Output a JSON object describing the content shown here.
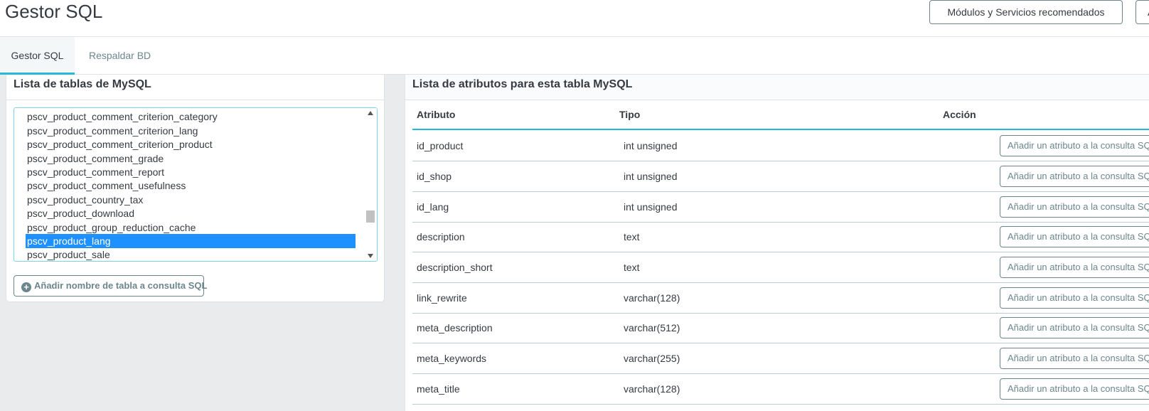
{
  "header": {
    "title": "Gestor SQL",
    "modules_button": "Módulos y Servicios recomendados",
    "cut_button": "A"
  },
  "tabs": [
    {
      "label": "Gestor SQL",
      "active": true
    },
    {
      "label": "Respaldar BD",
      "active": false
    }
  ],
  "left_panel": {
    "title": "Lista de tablas de MySQL",
    "tables": [
      "pscv_product_comment_criterion_category",
      "pscv_product_comment_criterion_lang",
      "pscv_product_comment_criterion_product",
      "pscv_product_comment_grade",
      "pscv_product_comment_report",
      "pscv_product_comment_usefulness",
      "pscv_product_country_tax",
      "pscv_product_download",
      "pscv_product_group_reduction_cache",
      "pscv_product_lang",
      "pscv_product_sale"
    ],
    "selected": "pscv_product_lang",
    "add_button": "Añadir nombre de tabla a consulta SQL"
  },
  "right_panel": {
    "title": "Lista de atributos para esta tabla MySQL",
    "columns": [
      "Atributo",
      "Tipo",
      "Acción"
    ],
    "rows": [
      {
        "attribute": "id_product",
        "type": "int unsigned",
        "action": "Añadir un atributo a la consulta SQL"
      },
      {
        "attribute": "id_shop",
        "type": "int unsigned",
        "action": "Añadir un atributo a la consulta SQL"
      },
      {
        "attribute": "id_lang",
        "type": "int unsigned",
        "action": "Añadir un atributo a la consulta SQL"
      },
      {
        "attribute": "description",
        "type": "text",
        "action": "Añadir un atributo a la consulta SQL"
      },
      {
        "attribute": "description_short",
        "type": "text",
        "action": "Añadir un atributo a la consulta SQL"
      },
      {
        "attribute": "link_rewrite",
        "type": "varchar(128)",
        "action": "Añadir un atributo a la consulta SQL"
      },
      {
        "attribute": "meta_description",
        "type": "varchar(512)",
        "action": "Añadir un atributo a la consulta SQL"
      },
      {
        "attribute": "meta_keywords",
        "type": "varchar(255)",
        "action": "Añadir un atributo a la consulta SQL"
      },
      {
        "attribute": "meta_title",
        "type": "varchar(128)",
        "action": "Añadir un atributo a la consulta SQL"
      }
    ]
  },
  "colors": {
    "accent": "#25b9d7",
    "selected": "#1e90ff",
    "border": "#bbcdd2",
    "text": "#363a41",
    "muted": "#6c868e"
  }
}
